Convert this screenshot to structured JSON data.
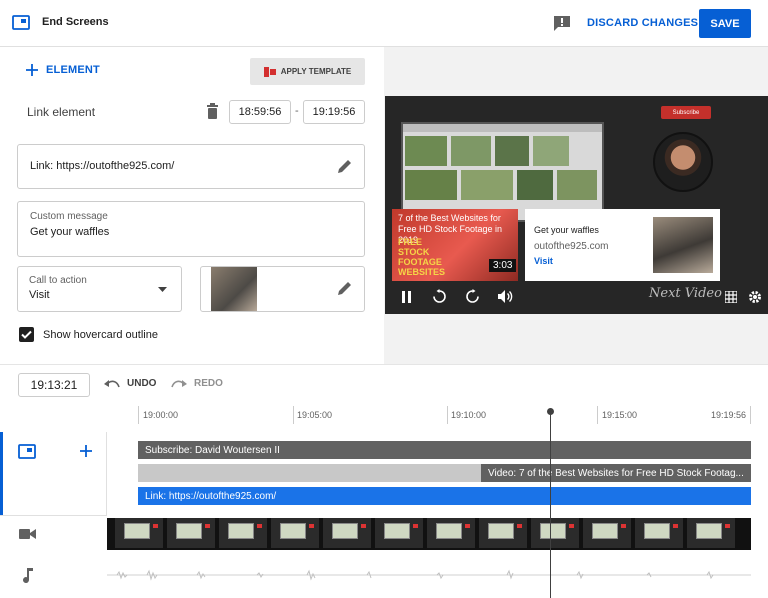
{
  "header": {
    "title": "End Screens",
    "discard_label": "DISCARD CHANGES",
    "save_label": "SAVE"
  },
  "editor": {
    "add_element_label": "ELEMENT",
    "apply_template_label": "APPLY TEMPLATE",
    "element_type_label": "Link element",
    "start_time": "18:59:56",
    "time_separator": "-",
    "end_time": "19:19:56",
    "link_value": "Link: https://outofthe925.com/",
    "custom_message_label": "Custom message",
    "custom_message_value": "Get your waffles",
    "cta_label": "Call to action",
    "cta_value": "Visit",
    "hovercard_label": "Show hovercard outline",
    "hovercard_checked": true
  },
  "preview": {
    "subscribe_label": "Subscribe",
    "video_card_title": "7 of the Best Websites for Free HD Stock Footage in 2019",
    "video_card_overlay": "FREE STOCK FOOTAGE WEBSITES",
    "video_card_duration": "3:03",
    "link_card_title": "Get your waffles",
    "link_card_domain": "outofthe925.com",
    "link_card_cta": "Visit",
    "watermark": "Next Video"
  },
  "timeline": {
    "current_time": "19:13:21",
    "undo_label": "UNDO",
    "redo_label": "REDO",
    "ticks": [
      "19:00:00",
      "19:05:00",
      "19:10:00",
      "19:15:00",
      "19:19:56"
    ],
    "tracks": {
      "subscribe": "Subscribe: David Woutersen II",
      "video": "Video: 7 of the Best Websites for Free HD Stock Footag...",
      "link": "Link: https://outofthe925.com/"
    }
  },
  "colors": {
    "accent": "#065fd4",
    "link_track": "#1a73e8",
    "subscribe_track": "#616161",
    "video_track": "#c8c8c8"
  }
}
